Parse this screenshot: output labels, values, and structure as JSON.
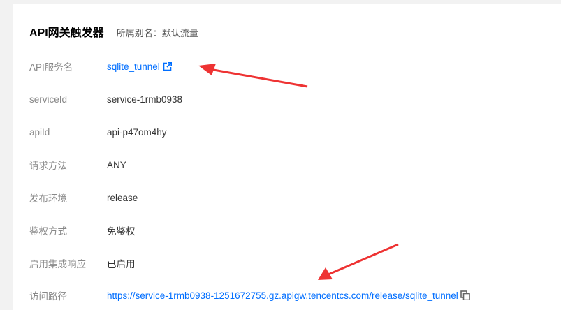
{
  "header": {
    "title": "API网关触发器",
    "alias": "所属别名：默认流量"
  },
  "rows": [
    {
      "label": "API服务名",
      "value": "sqlite_tunnel"
    },
    {
      "label": "serviceId",
      "value": "service-1rmb0938"
    },
    {
      "label": "apiId",
      "value": "api-p47om4hy"
    },
    {
      "label": "请求方法",
      "value": "ANY"
    },
    {
      "label": "发布环境",
      "value": "release"
    },
    {
      "label": "鉴权方式",
      "value": "免鉴权"
    },
    {
      "label": "启用集成响应",
      "value": "已启用"
    },
    {
      "label": "访问路径",
      "value": "https://service-1rmb0938-1251672755.gz.apigw.tencentcs.com/release/sqlite_tunnel"
    }
  ],
  "icons": {
    "external_link": "external-link-icon",
    "copy": "copy-icon"
  },
  "colors": {
    "link": "#006eff",
    "annotation_arrow": "#ee3333"
  }
}
